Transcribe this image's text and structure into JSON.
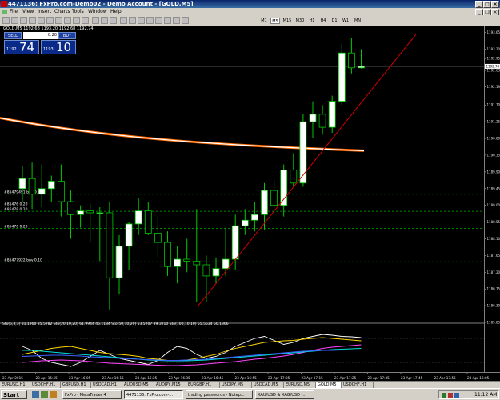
{
  "window": {
    "title": "4471136: FxPro.com-Demo02 - Demo Account - [GOLD,M5]",
    "controls": [
      "_",
      "□",
      "×"
    ]
  },
  "menu": [
    "File",
    "View",
    "Insert",
    "Charts",
    "Tools",
    "Window",
    "Help"
  ],
  "timeframes": [
    "M1",
    "M5",
    "M15",
    "M30",
    "H1",
    "H4",
    "D1",
    "W1",
    "MN"
  ],
  "selected_timeframe": "M5",
  "chart_header": "GOLD,M5  1192.68 1193.20 1192.68 1192.74",
  "one_click": {
    "sell_label": "SELL",
    "buy_label": "BUY",
    "lot": "0.20",
    "sell_small": "1192",
    "sell_big": "74",
    "buy_small": "1193",
    "buy_big": "10"
  },
  "orders": [
    {
      "label": "#85479491 buy 0.10",
      "price": 1189.3
    },
    {
      "label": "#85476 0.20",
      "price": 1188.98
    },
    {
      "label": "#85478 0.20",
      "price": 1188.84
    },
    {
      "label": "#85476 0.20",
      "price": 1188.38
    },
    {
      "label": "#85477922 buy 0.10",
      "price": 1187.48
    }
  ],
  "price_axis": [
    "1193.65",
    "1193.20",
    "1192.95",
    "1192.63",
    "1192.19",
    "1191.70",
    "1191.25",
    "1190.80",
    "1190.35",
    "1189.90",
    "1189.45",
    "1189.00",
    "1188.55",
    "1188.10",
    "1187.65",
    "1187.20",
    "1186.75",
    "1186.30",
    "1185.85"
  ],
  "current_price_label": "1192.74",
  "time_axis": [
    "23 Apr 2015",
    "23 Apr 15:55",
    "23 Apr 16:05",
    "23 Apr 16:15",
    "23 Apr 16:25",
    "23 Apr 16:35",
    "23 Apr 16:45",
    "23 Apr 16:55",
    "23 Apr 17:05",
    "23 Apr 17:15",
    "23 Apr 17:25",
    "23 Apr 17:35",
    "23 Apr 17:45",
    "23 Apr 17:55",
    "23 Apr 18:05"
  ],
  "indicator_header": "Sto(5,3,3) 81.1900 85.5782  Sto(20,10,20) 61.9944 46.1184  Sto(50,10,20) 53.5207 39.3210  Sto(100,10,10) 55.5534 50.1866",
  "symbol_tabs": [
    "EURUSD,H1",
    "USDCHF,H1",
    "GBPUSD,H1",
    "USDCAD,H1",
    "AUDUSD,M5",
    "AUDJPY,M15",
    "EURGBP,H1",
    "USDJPY,M5",
    "USDCAD,M5",
    "EURUSD,M5",
    "GOLD,M5",
    "USDCHF,H1"
  ],
  "active_symbol_tab": "GOLD,M5",
  "taskbar": {
    "start": "Start",
    "tasks": [
      "FxPro - MetaTrader 4",
      "4471136: FxPro.com-...",
      "trading passwords - Notep...",
      "XAU/USD & XAG/USD -..."
    ],
    "time": "11:12 AM"
  },
  "colors": {
    "bull": "#ffffff",
    "bear_fill": "#000000",
    "candle_stroke": "#00c800",
    "order_line": "#00b000",
    "ma_orange": "#ff6a00",
    "ma_white": "#ffffff",
    "trendline": "#d00000"
  },
  "chart_data": {
    "type": "candlestick",
    "ylim": [
      1185.85,
      1193.75
    ],
    "ma_series": [
      {
        "values_start": 1191.35,
        "values_end": 1190.47
      }
    ],
    "candles": [
      [
        1189.45,
        1190.05,
        1189.1,
        1189.72
      ],
      [
        1189.72,
        1190.15,
        1188.9,
        1189.3
      ],
      [
        1189.3,
        1190.1,
        1188.95,
        1189.45
      ],
      [
        1189.45,
        1189.8,
        1189.1,
        1189.65
      ],
      [
        1189.65,
        1190.1,
        1188.7,
        1189.1
      ],
      [
        1189.1,
        1189.4,
        1188.1,
        1188.75
      ],
      [
        1188.75,
        1189.0,
        1188.4,
        1188.85
      ],
      [
        1188.85,
        1189.05,
        1188.0,
        1188.8
      ],
      [
        1188.8,
        1188.95,
        1187.5,
        1188.8
      ],
      [
        1188.8,
        1189.1,
        1186.2,
        1187.05
      ],
      [
        1187.05,
        1188.2,
        1186.6,
        1187.9
      ],
      [
        1187.9,
        1188.55,
        1187.25,
        1188.5
      ],
      [
        1188.5,
        1189.2,
        1188.2,
        1188.85
      ],
      [
        1188.85,
        1189.1,
        1188.2,
        1188.25
      ],
      [
        1188.25,
        1188.7,
        1187.6,
        1188.0
      ],
      [
        1188.0,
        1188.3,
        1187.1,
        1187.35
      ],
      [
        1187.35,
        1187.9,
        1186.9,
        1187.55
      ],
      [
        1187.55,
        1188.1,
        1187.2,
        1187.5
      ],
      [
        1187.5,
        1188.9,
        1186.4,
        1187.4
      ],
      [
        1187.4,
        1187.65,
        1186.4,
        1187.1
      ],
      [
        1187.1,
        1187.6,
        1186.9,
        1187.3
      ],
      [
        1187.3,
        1188.4,
        1187.1,
        1187.55
      ],
      [
        1187.55,
        1188.75,
        1187.25,
        1188.45
      ],
      [
        1188.45,
        1188.9,
        1188.2,
        1188.6
      ],
      [
        1188.6,
        1189.1,
        1188.3,
        1188.75
      ],
      [
        1188.75,
        1189.6,
        1188.35,
        1189.4
      ],
      [
        1189.4,
        1189.7,
        1188.8,
        1189.0
      ],
      [
        1189.0,
        1190.1,
        1188.7,
        1189.95
      ],
      [
        1189.95,
        1190.4,
        1189.5,
        1189.6
      ],
      [
        1189.6,
        1191.45,
        1189.5,
        1191.25
      ],
      [
        1191.25,
        1191.8,
        1190.8,
        1191.45
      ],
      [
        1191.45,
        1191.7,
        1190.9,
        1191.1
      ],
      [
        1191.1,
        1191.95,
        1190.95,
        1191.8
      ],
      [
        1191.8,
        1193.35,
        1191.7,
        1193.1
      ],
      [
        1193.1,
        1193.5,
        1192.55,
        1192.7
      ],
      [
        1192.7,
        1193.2,
        1192.68,
        1192.74
      ]
    ],
    "trendline": {
      "from": [
        18,
        1186.3
      ],
      "to": [
        40,
        1193.6
      ]
    }
  }
}
